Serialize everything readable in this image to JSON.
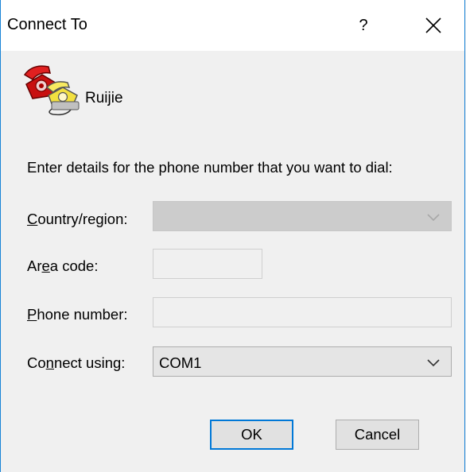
{
  "window": {
    "title": "Connect To",
    "help_glyph": "?",
    "close_icon": "close-icon"
  },
  "connection": {
    "icon": "phone-icon",
    "name": "Ruijie"
  },
  "instructions": "Enter details for the phone number that you want to dial:",
  "fields": {
    "country": {
      "label_pre": "",
      "label_ul": "C",
      "label_post": "ountry/region:",
      "value": "",
      "disabled": true
    },
    "area": {
      "label_pre": "Ar",
      "label_ul": "e",
      "label_post": "a code:",
      "value": ""
    },
    "phone": {
      "label_pre": "",
      "label_ul": "P",
      "label_post": "hone number:",
      "value": ""
    },
    "connect": {
      "label_pre": "Co",
      "label_ul": "n",
      "label_post": "nect using:",
      "value": "COM1"
    }
  },
  "buttons": {
    "ok": "OK",
    "cancel": "Cancel"
  },
  "colors": {
    "accent": "#0078d7",
    "window_border": "#1883d7"
  }
}
